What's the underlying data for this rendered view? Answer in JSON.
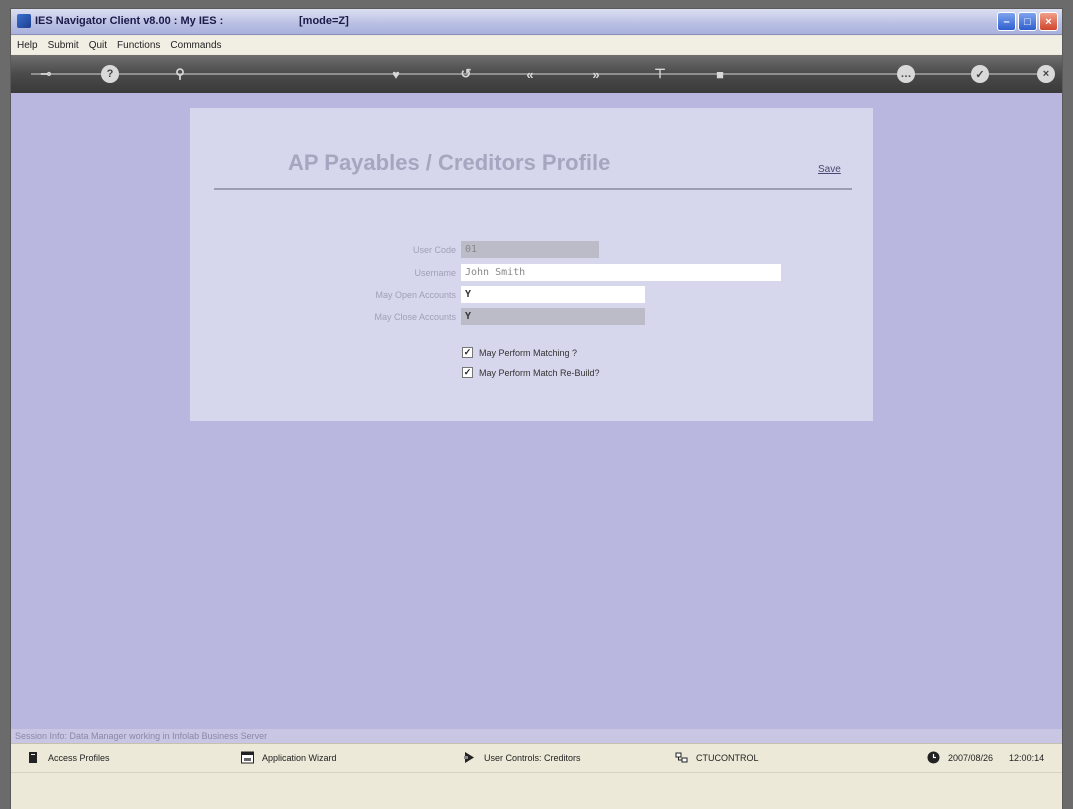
{
  "window": {
    "title": "IES Navigator Client v8.00 : My IES :",
    "mode": "[mode=Z]"
  },
  "menu": [
    "Help",
    "Submit",
    "Quit",
    "Functions",
    "Commands"
  ],
  "toolbar": {
    "icons": [
      "key-icon",
      "help-icon",
      "search-icon",
      "heart-icon",
      "undo-icon",
      "rewind-icon",
      "forward-icon",
      "marker-icon",
      "square-icon",
      "ellipsis-icon",
      "check-icon",
      "close-icon"
    ]
  },
  "form": {
    "title": "AP Payables / Creditors Profile",
    "save_label": "Save",
    "fields": {
      "user_code": {
        "label": "User Code",
        "value": "01"
      },
      "username": {
        "label": "Username",
        "value": "John Smith"
      },
      "may_open_accounts": {
        "label": "May Open Accounts",
        "value": "Y"
      },
      "may_close_accounts": {
        "label": "May Close Accounts",
        "value": "Y"
      }
    },
    "checks": [
      {
        "label": "May Perform Matching ?",
        "checked": true
      },
      {
        "label": "May Perform Match Re-Build?",
        "checked": true
      }
    ]
  },
  "session_info": "Session Info: Data Manager working in Infolab Business Server",
  "statusbar": {
    "access_profiles": "Access Profiles",
    "application_wizard": "Application Wizard",
    "user_controls": "User Controls: Creditors",
    "control": "CTUCONTROL",
    "date": "2007/08/26",
    "time": "12:00:14"
  }
}
